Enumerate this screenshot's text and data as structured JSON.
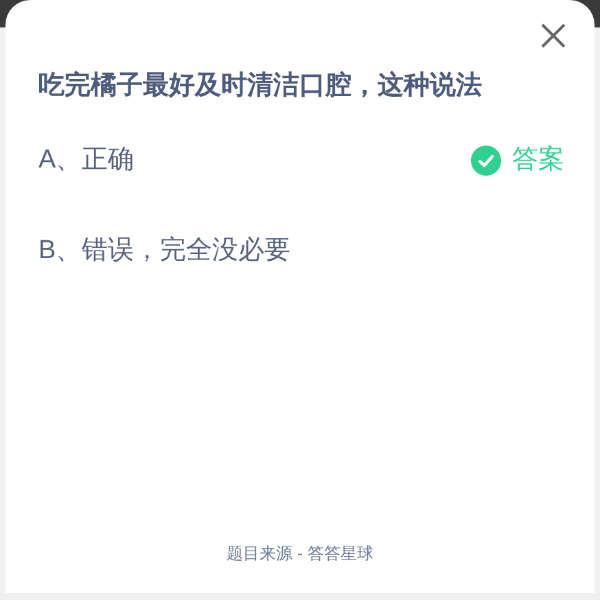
{
  "question": "吃完橘子最好及时清洁口腔，这种说法",
  "options": [
    {
      "label": "A、正确",
      "correct": true,
      "badge": "答案"
    },
    {
      "label": "B、错误，完全没必要",
      "correct": false
    }
  ],
  "footer": "题目来源 - 答答星球"
}
